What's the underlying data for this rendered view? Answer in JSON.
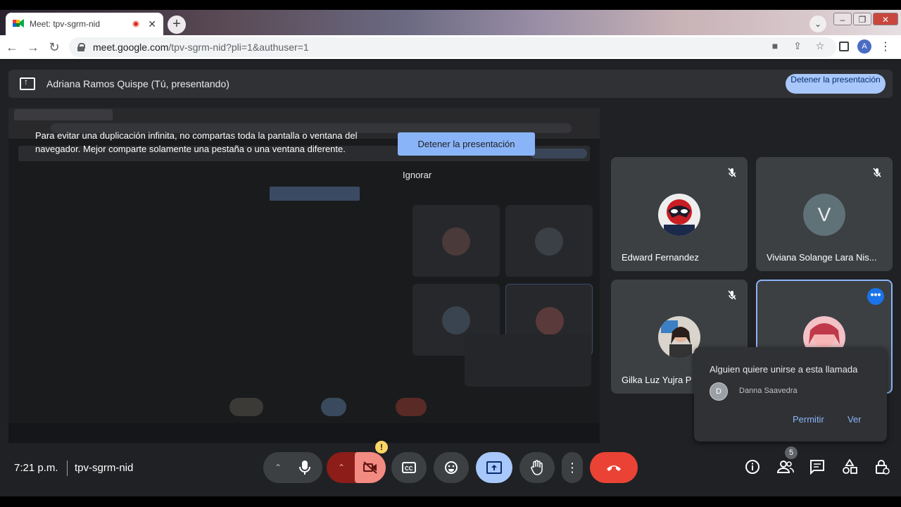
{
  "browser": {
    "tab_title": "Meet: tpv-sgrm-nid",
    "url_host": "meet.google.com",
    "url_path": "/tpv-sgrm-nid?pli=1&authuser=1",
    "profile_initial": "A"
  },
  "presenting_bar": {
    "presenter": "Adriana Ramos Quispe (Tú, presentando)",
    "stop_button": "Detener la presentación"
  },
  "duplication_warning": {
    "message": "Para evitar una duplicación infinita, no compartas toda la pantalla o ventana del navegador. Mejor comparte solamente una pestaña o una ventana diferente.",
    "stop_button": "Detener la presentación",
    "ignore_button": "Ignorar"
  },
  "participants": [
    {
      "name": "Edward Fernandez",
      "muted": true
    },
    {
      "name": "Viviana Solange Lara Nis...",
      "initial": "V",
      "muted": true
    },
    {
      "name": "Gilka Luz Yujra P",
      "muted": true
    },
    {
      "name": "",
      "muted": false,
      "active": true
    }
  ],
  "join_request": {
    "title": "Alguien quiere unirse a esta llamada",
    "initial": "D",
    "name": "Danna Saavedra",
    "allow": "Permitir",
    "view": "Ver"
  },
  "bottom_bar": {
    "time": "7:21 p.m.",
    "meeting_code": "tpv-sgrm-nid",
    "participant_count": "5",
    "warning_badge": "!"
  },
  "colors": {
    "background": "#202124",
    "tile": "#3c4043",
    "accent": "#8ab4f8",
    "hangup": "#ea4335",
    "camera_off": "#f28b82"
  }
}
